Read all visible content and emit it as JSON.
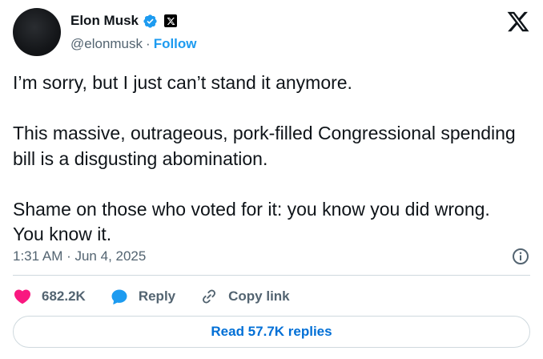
{
  "author": {
    "name": "Elon Musk",
    "handle": "@elonmusk",
    "separator": "·",
    "follow_label": "Follow"
  },
  "tweet": {
    "paragraphs": [
      "I’m sorry, but I just can’t stand it anymore.",
      "This massive, outrageous, pork-filled Congressional spending bill is a disgusting abomination.",
      "Shame on those who voted for it: you know you did wrong. You know it."
    ],
    "timestamp": "1:31 AM · Jun 4, 2025"
  },
  "actions": {
    "likes_count": "682.2K",
    "reply_label": "Reply",
    "copy_link_label": "Copy link"
  },
  "footer": {
    "read_replies_label": "Read 57.7K replies"
  },
  "icons": {
    "verified": "verified-badge-icon",
    "affiliate": "x-badge-icon",
    "logo": "x-logo-icon",
    "info": "info-icon",
    "like": "heart-icon",
    "reply": "speech-bubble-icon",
    "copy_link": "link-icon"
  },
  "colors": {
    "accent": "#1d9bf0",
    "heart": "#f91880",
    "text_primary": "#0f1419",
    "text_secondary": "#536471",
    "border": "#cfd9de",
    "link_dark": "#006fd6"
  }
}
